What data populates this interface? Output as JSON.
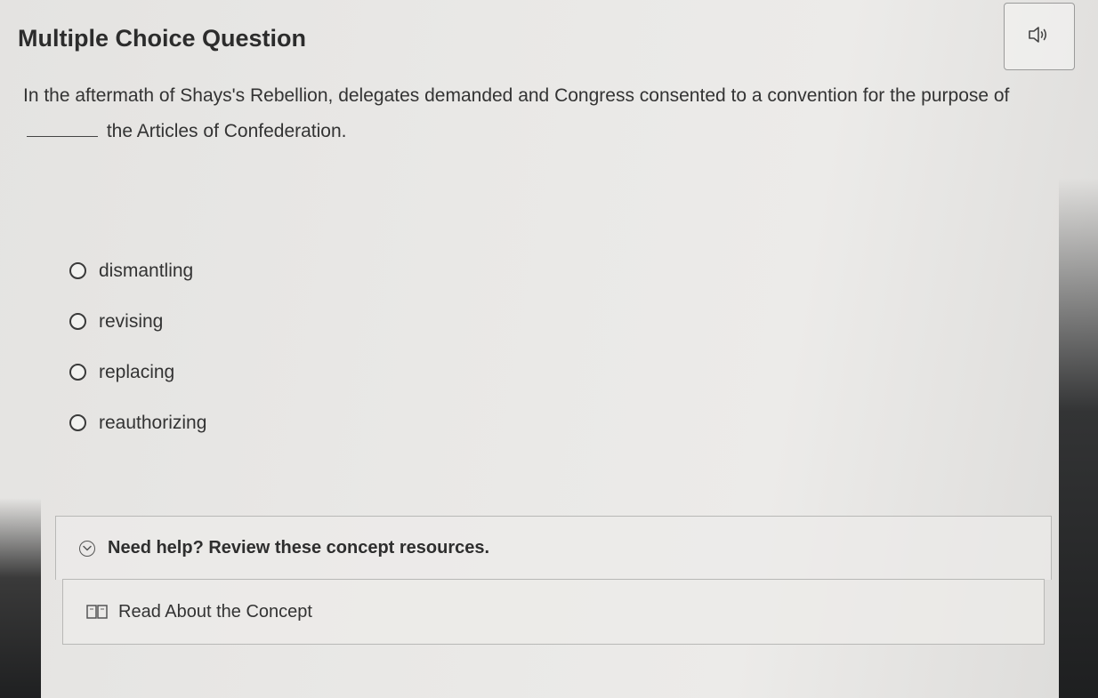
{
  "header": {
    "title": "Multiple Choice Question",
    "audio_icon": "speaker-icon"
  },
  "question": {
    "text_before": "In the aftermath of Shays's Rebellion, delegates demanded and Congress consented to a convention for the purpose of",
    "text_after": "the Articles of Confederation."
  },
  "options": [
    {
      "label": "dismantling",
      "selected": false
    },
    {
      "label": "revising",
      "selected": false
    },
    {
      "label": "replacing",
      "selected": false
    },
    {
      "label": "reauthorizing",
      "selected": false
    }
  ],
  "help": {
    "label": "Need help? Review these concept resources.",
    "icon": "chevron-down-circle-icon",
    "resources": [
      {
        "label": "Read About the Concept",
        "icon": "book-icon"
      }
    ]
  }
}
